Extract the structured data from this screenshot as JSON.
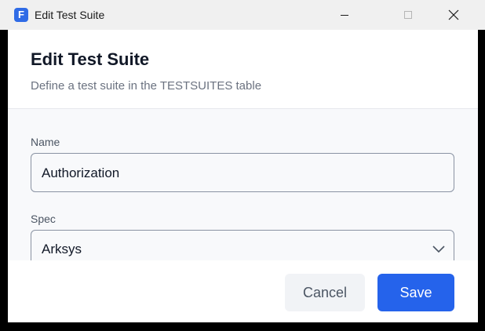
{
  "window": {
    "title": "Edit Test Suite",
    "app_icon_letter": "F",
    "app_icon_color": "#2f6be6",
    "controls": [
      "minimize-icon",
      "maximize-icon",
      "close-icon"
    ]
  },
  "dialog": {
    "title": "Edit Test Suite",
    "subtitle": "Define a test suite in the TESTSUITES table"
  },
  "form": {
    "name": {
      "label": "Name",
      "value": "Authorization"
    },
    "spec": {
      "label": "Spec",
      "selected": "Arksys",
      "icon": "chevron-down-icon"
    }
  },
  "actions": {
    "cancel_label": "Cancel",
    "save_label": "Save",
    "accent_color": "#2563eb"
  }
}
